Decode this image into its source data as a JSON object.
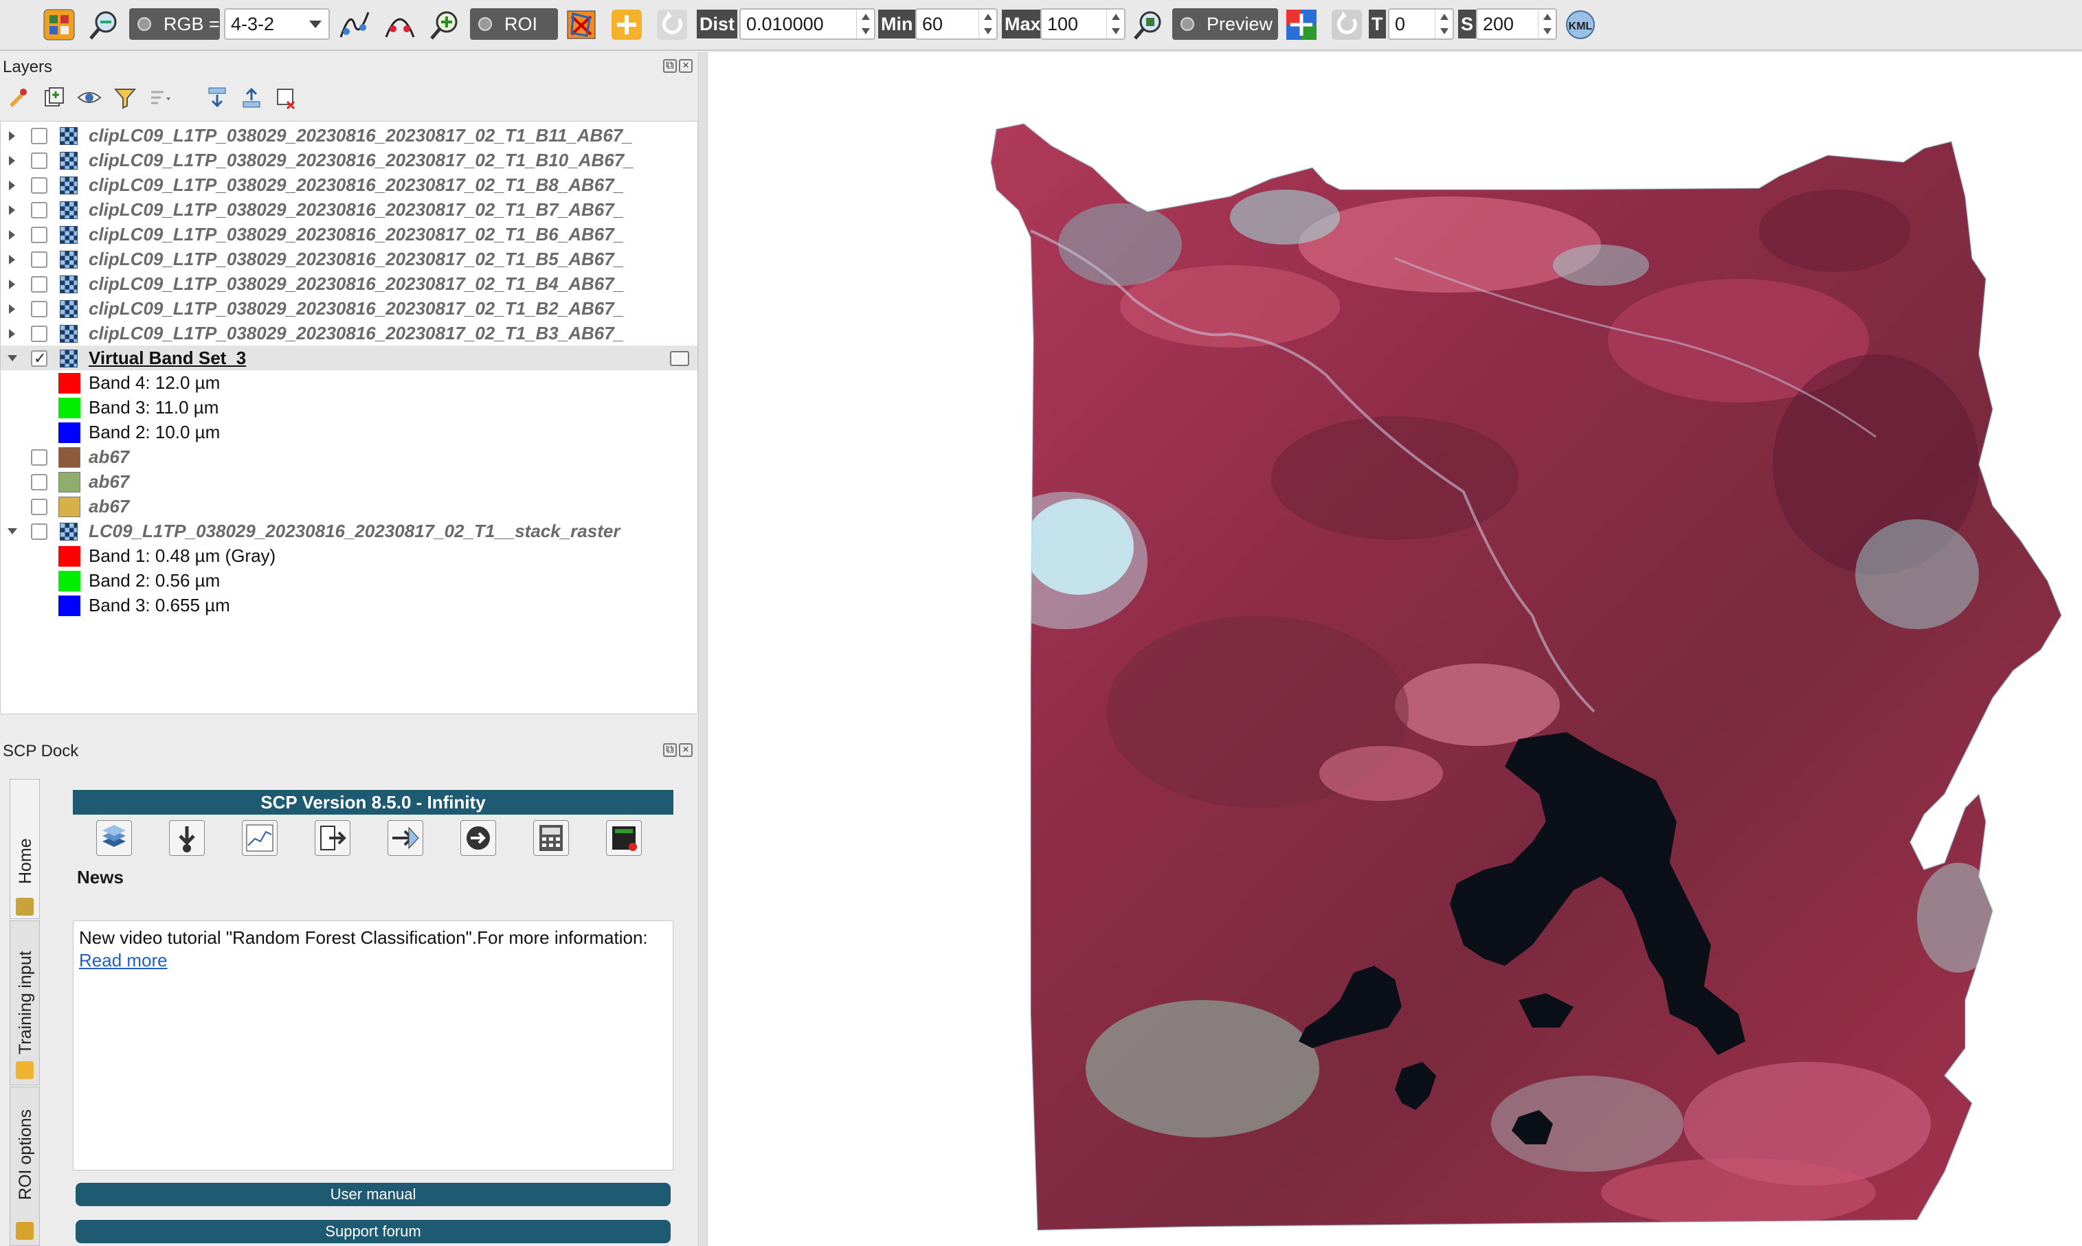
{
  "toolbar": {
    "rgb_label": "RGB =",
    "rgb_combo": "4-3-2",
    "roi_label": "ROI",
    "dist_label": "Dist",
    "dist_value": "0.010000",
    "min_label": "Min",
    "min_value": "60",
    "max_label": "Max",
    "max_value": "100",
    "preview_label": "Preview",
    "t_label": "T",
    "t_value": "0",
    "s_label": "S",
    "s_value": "200",
    "kml_label": "KML"
  },
  "layers": {
    "title": "Layers",
    "rows": [
      {
        "type": "raster",
        "name": "clipLC09_L1TP_038029_20230816_20230817_02_T1_B11_AB67_",
        "expanded": false,
        "checked": false
      },
      {
        "type": "raster",
        "name": "clipLC09_L1TP_038029_20230816_20230817_02_T1_B10_AB67_",
        "expanded": false,
        "checked": false
      },
      {
        "type": "raster",
        "name": "clipLC09_L1TP_038029_20230816_20230817_02_T1_B8_AB67_",
        "expanded": false,
        "checked": false
      },
      {
        "type": "raster",
        "name": "clipLC09_L1TP_038029_20230816_20230817_02_T1_B7_AB67_",
        "expanded": false,
        "checked": false
      },
      {
        "type": "raster",
        "name": "clipLC09_L1TP_038029_20230816_20230817_02_T1_B6_AB67_",
        "expanded": false,
        "checked": false
      },
      {
        "type": "raster",
        "name": "clipLC09_L1TP_038029_20230816_20230817_02_T1_B5_AB67_",
        "expanded": false,
        "checked": false
      },
      {
        "type": "raster",
        "name": "clipLC09_L1TP_038029_20230816_20230817_02_T1_B4_AB67_",
        "expanded": false,
        "checked": false
      },
      {
        "type": "raster",
        "name": "clipLC09_L1TP_038029_20230816_20230817_02_T1_B2_AB67_",
        "expanded": false,
        "checked": false
      },
      {
        "type": "raster",
        "name": "clipLC09_L1TP_038029_20230816_20230817_02_T1_B3_AB67_",
        "expanded": false,
        "checked": false
      },
      {
        "type": "raster",
        "name": "Virtual Band Set_3",
        "expanded": true,
        "checked": true,
        "active": true
      },
      {
        "type": "band",
        "name": "Band 4: 12.0  µm",
        "color": "#ff0000"
      },
      {
        "type": "band",
        "name": "Band 3: 11.0  µm",
        "color": "#00ee00"
      },
      {
        "type": "band",
        "name": "Band 2: 10.0  µm",
        "color": "#0000ff"
      },
      {
        "type": "vector",
        "name": "ab67",
        "color": "#8e5a3c",
        "checked": false
      },
      {
        "type": "vector",
        "name": "ab67",
        "color": "#8fae6e",
        "checked": false
      },
      {
        "type": "vector",
        "name": "ab67",
        "color": "#d6b14a",
        "checked": false
      },
      {
        "type": "raster",
        "name": "LC09_L1TP_038029_20230816_20230817_02_T1__stack_raster",
        "expanded": true,
        "checked": false
      },
      {
        "type": "band",
        "name": "Band 1: 0.48  µm (Gray)",
        "color": "#ff0000"
      },
      {
        "type": "band",
        "name": "Band 2: 0.56  µm",
        "color": "#00ee00"
      },
      {
        "type": "band",
        "name": "Band 3: 0.655 µm",
        "color": "#0000ff"
      }
    ]
  },
  "scp": {
    "dock_title": "SCP Dock",
    "version_title": "SCP Version 8.5.0 - Infinity",
    "tabs": [
      "Home",
      "Training input",
      "ROI options"
    ],
    "news_label": "News",
    "news_text": "New video tutorial \"Random Forest Classification\".For more information: ",
    "news_link": "Read more",
    "user_manual": "User manual",
    "support_forum": "Support forum"
  },
  "colors": {
    "scp_accent": "#1e5a72",
    "map_background": "#ffffff",
    "false_color_vegetation": "#a8324f",
    "lake": "#0b0f17"
  }
}
